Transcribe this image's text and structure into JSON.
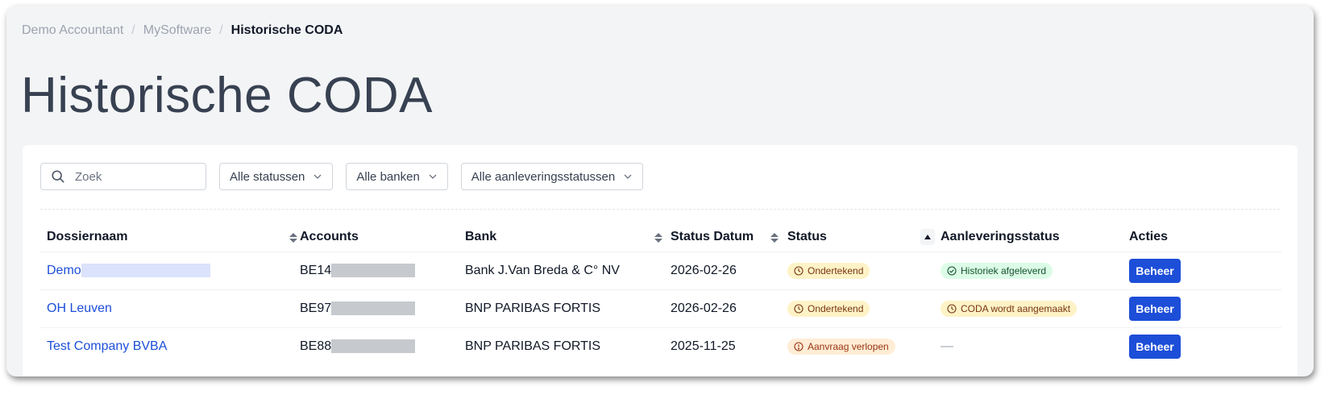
{
  "breadcrumb": [
    "Demo Accountant",
    "MySoftware",
    "Historische CODA"
  ],
  "page_title": "Historische CODA",
  "filters": {
    "search_placeholder": "Zoek",
    "status_select": "Alle statussen",
    "bank_select": "Alle banken",
    "delivery_select": "Alle aanleveringsstatussen"
  },
  "table": {
    "headers": {
      "dossier": "Dossiernaam",
      "accounts": "Accounts",
      "bank": "Bank",
      "status_date": "Status Datum",
      "status": "Status",
      "delivery": "Aanleveringsstatus",
      "actions": "Acties"
    },
    "rows": [
      {
        "dossier": "Demo",
        "account": "BE14",
        "bank": "Bank J.Van Breda & C° NV",
        "date": "2026-02-26",
        "status": "Ondertekend",
        "delivery": "Historiek afgeleverd",
        "action": "Beheer"
      },
      {
        "dossier": "OH Leuven",
        "account": "BE97",
        "bank": "BNP PARIBAS FORTIS",
        "date": "2026-02-26",
        "status": "Ondertekend",
        "delivery": "CODA wordt aangemaakt",
        "action": "Beheer"
      },
      {
        "dossier": "Test Company BVBA",
        "account": "BE88",
        "bank": "BNP PARIBAS FORTIS",
        "date": "2025-11-25",
        "status": "Aanvraag verlopen",
        "delivery": "—",
        "action": "Beheer"
      }
    ]
  },
  "colors": {
    "accent": "#1d4ed8",
    "badge_yellow": "#fef3c7",
    "badge_green": "#dcfce7",
    "badge_orange": "#ffedd5"
  }
}
